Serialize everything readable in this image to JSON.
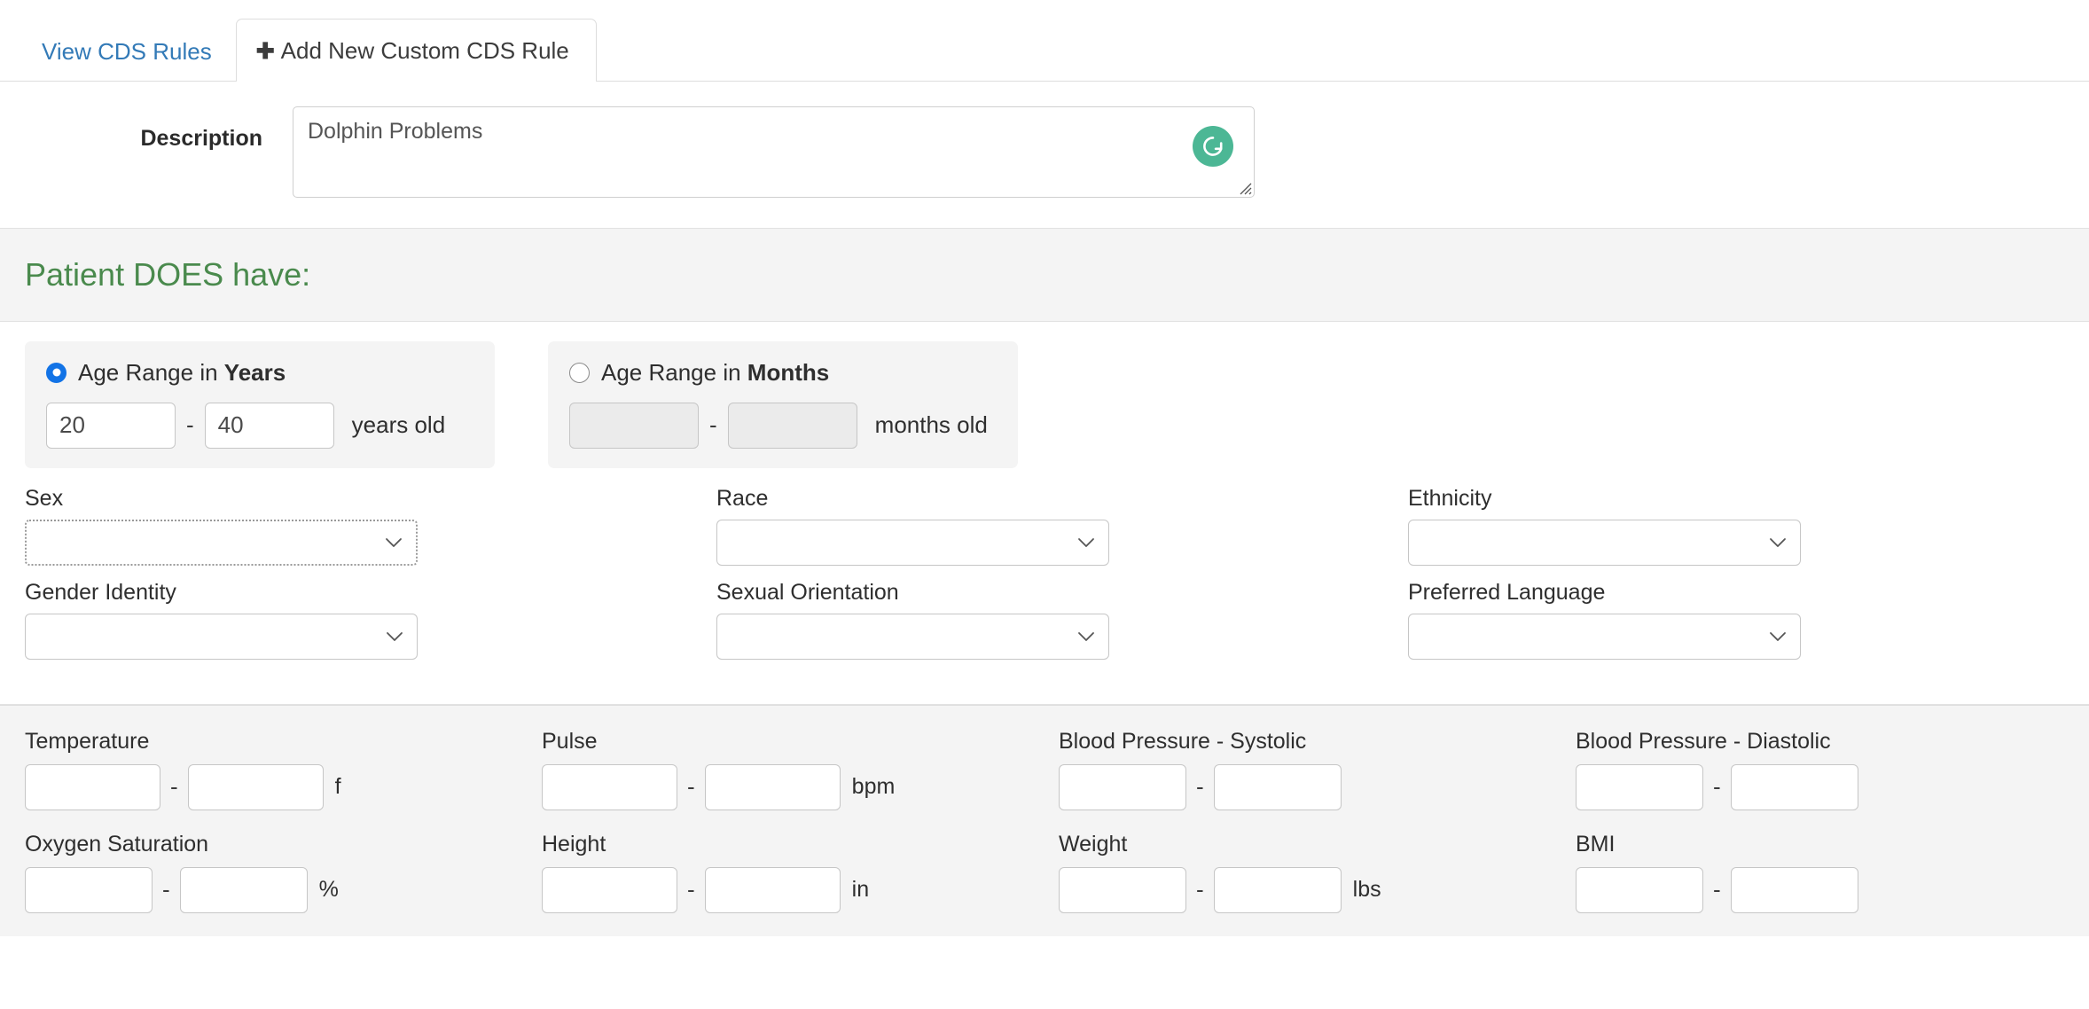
{
  "tabs": [
    {
      "label": "View CDS Rules",
      "active": false,
      "icon": null
    },
    {
      "label": "Add New Custom CDS Rule",
      "active": true,
      "icon": "plus-icon"
    }
  ],
  "description": {
    "label": "Description",
    "value": "Dolphin Problems",
    "placeholder": "",
    "assistant_icon": "grammarly-icon",
    "assistant_glyph": "G",
    "assistant_color": "#4cb795"
  },
  "section": {
    "heading": "Patient DOES have:",
    "heading_color": "#4a8a4d"
  },
  "age": {
    "years": {
      "radio_label_prefix": "Age Range in ",
      "radio_label_strong": "Years",
      "selected": true,
      "min": "20",
      "max": "40",
      "separator": "-",
      "unit": "years old",
      "disabled": false
    },
    "months": {
      "radio_label_prefix": "Age Range in ",
      "radio_label_strong": "Months",
      "selected": false,
      "min": "",
      "max": "",
      "separator": "-",
      "unit": "months old",
      "disabled": true
    }
  },
  "dropdowns": [
    {
      "label": "Sex",
      "value": "",
      "focused": true
    },
    {
      "label": "Race",
      "value": "",
      "focused": false
    },
    {
      "label": "Ethnicity",
      "value": "",
      "focused": false
    },
    {
      "label": "Gender Identity",
      "value": "",
      "focused": false
    },
    {
      "label": "Sexual Orientation",
      "value": "",
      "focused": false
    },
    {
      "label": "Preferred Language",
      "value": "",
      "focused": false
    }
  ],
  "vitals": [
    {
      "label": "Temperature",
      "min": "",
      "max": "",
      "separator": "-",
      "unit": "f"
    },
    {
      "label": "Pulse",
      "min": "",
      "max": "",
      "separator": "-",
      "unit": "bpm"
    },
    {
      "label": "Blood Pressure - Systolic",
      "min": "",
      "max": "",
      "separator": "-",
      "unit": ""
    },
    {
      "label": "Blood Pressure - Diastolic",
      "min": "",
      "max": "",
      "separator": "-",
      "unit": ""
    },
    {
      "label": "Oxygen Saturation",
      "min": "",
      "max": "",
      "separator": "-",
      "unit": "%"
    },
    {
      "label": "Height",
      "min": "",
      "max": "",
      "separator": "-",
      "unit": "in"
    },
    {
      "label": "Weight",
      "min": "",
      "max": "",
      "separator": "-",
      "unit": "lbs"
    },
    {
      "label": "BMI",
      "min": "",
      "max": "",
      "separator": "-",
      "unit": ""
    }
  ]
}
